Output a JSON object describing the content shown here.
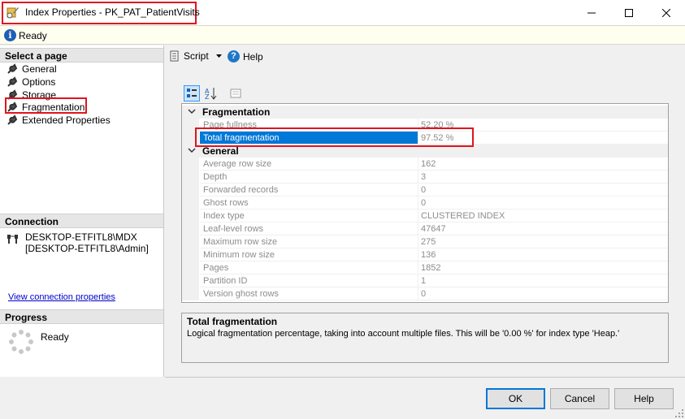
{
  "window": {
    "title": "Index Properties - PK_PAT_PatientVisits",
    "minimize_icon": "minimize-icon",
    "maximize_icon": "maximize-icon",
    "close_icon": "close-icon"
  },
  "status": {
    "text": "Ready",
    "icon": "info-icon"
  },
  "left": {
    "select_page_header": "Select a page",
    "pages": [
      {
        "label": "General",
        "icon": "wrench-icon"
      },
      {
        "label": "Options",
        "icon": "wrench-icon"
      },
      {
        "label": "Storage",
        "icon": "wrench-icon"
      },
      {
        "label": "Fragmentation",
        "icon": "wrench-icon"
      },
      {
        "label": "Extended Properties",
        "icon": "wrench-icon"
      }
    ],
    "connection_header": "Connection",
    "connection_server": "DESKTOP-ETFITL8\\MDX",
    "connection_user": "[DESKTOP-ETFITL8\\Admin]",
    "view_connection_link": "View connection properties",
    "progress_header": "Progress",
    "progress_status": "Ready"
  },
  "toolbar": {
    "script_label": "Script",
    "help_label": "Help"
  },
  "grid": {
    "categories": [
      {
        "label": "Fragmentation",
        "rows": [
          {
            "name": "Page fullness",
            "value": "52.20 %"
          },
          {
            "name": "Total fragmentation",
            "value": "97.52 %",
            "selected": true
          }
        ]
      },
      {
        "label": "General",
        "rows": [
          {
            "name": "Average row size",
            "value": "162"
          },
          {
            "name": "Depth",
            "value": "3"
          },
          {
            "name": "Forwarded records",
            "value": "0"
          },
          {
            "name": "Ghost rows",
            "value": "0"
          },
          {
            "name": "Index type",
            "value": "CLUSTERED INDEX"
          },
          {
            "name": "Leaf-level rows",
            "value": "47647"
          },
          {
            "name": "Maximum row size",
            "value": "275"
          },
          {
            "name": "Minimum row size",
            "value": "136"
          },
          {
            "name": "Pages",
            "value": "1852"
          },
          {
            "name": "Partition ID",
            "value": "1"
          },
          {
            "name": "Version ghost rows",
            "value": "0"
          }
        ]
      }
    ]
  },
  "description": {
    "title": "Total fragmentation",
    "text": "Logical fragmentation percentage, taking into account multiple files.  This will be '0.00 %' for index type 'Heap.'"
  },
  "buttons": {
    "ok": "OK",
    "cancel": "Cancel",
    "help": "Help"
  },
  "colors": {
    "selection": "#0078d7",
    "highlight_box": "#e0141e",
    "link": "#0000cc"
  }
}
